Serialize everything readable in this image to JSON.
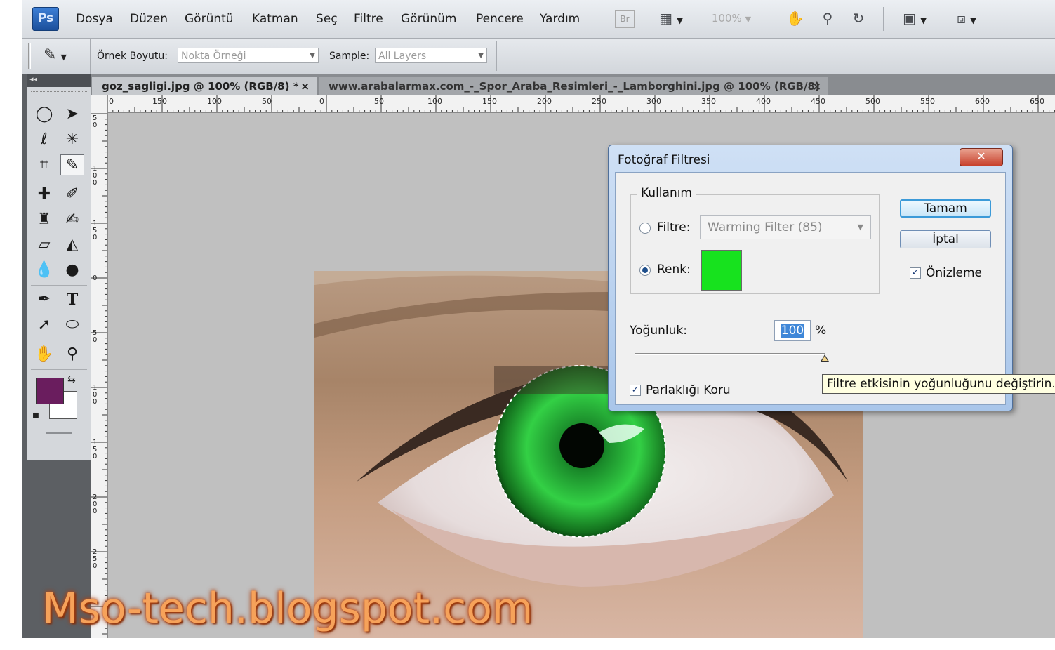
{
  "app": {
    "logo": "Ps",
    "menu": [
      "Dosya",
      "Düzen",
      "Görüntü",
      "Katman",
      "Seç",
      "Filtre",
      "Görünüm",
      "Pencere",
      "Yardım"
    ],
    "bridge_label": "Br",
    "zoom": "100%"
  },
  "options_bar": {
    "sample_size_label": "Örnek Boyutu:",
    "sample_size_value": "Nokta Örneği",
    "sample_label": "Sample:",
    "sample_value": "All Layers"
  },
  "tabs": [
    {
      "label": "goz_sagligi.jpg @ 100% (RGB/8) *",
      "close": "×"
    },
    {
      "label": "www.arabalarmax.com_-_Spor_Araba_Resimleri_-_Lamborghini.jpg @ 100% (RGB/8)",
      "close": "×"
    }
  ],
  "rulers": {
    "horizontal": [
      "0",
      "150",
      "100",
      "50",
      "0",
      "50",
      "100",
      "150",
      "200",
      "250",
      "300",
      "350",
      "400",
      "450",
      "500",
      "550",
      "600",
      "650"
    ],
    "vertical": [
      "50",
      "100",
      "150",
      "0",
      "50",
      "100",
      "150",
      "200",
      "250"
    ]
  },
  "toolbar": {
    "foreground_color": "#6a1d5e",
    "background_color": "#ffffff",
    "tools": [
      "marquee-tool",
      "move-tool",
      "lasso-tool",
      "magic-wand-tool",
      "crop-tool",
      "eyedropper-tool",
      "healing-brush-tool",
      "brush-tool",
      "clone-stamp-tool",
      "history-brush-tool",
      "eraser-tool",
      "paint-bucket-tool",
      "blur-tool",
      "dodge-tool",
      "pen-tool",
      "type-tool",
      "path-selection-tool",
      "ellipse-tool",
      "hand-tool",
      "zoom-tool"
    ]
  },
  "dialog": {
    "title": "Fotoğraf Filtresi",
    "close": "✕",
    "group_label": "Kullanım",
    "filter_label": "Filtre:",
    "filter_value": "Warming Filter (85)",
    "color_label": "Renk:",
    "color_value": "#17e21e",
    "ok_button": "Tamam",
    "cancel_button": "İptal",
    "preview_label": "Önizleme",
    "preview_checked": true,
    "density_label": "Yoğunluk:",
    "density_value": "100",
    "density_unit": "%",
    "density_fraction": 1.0,
    "preserve_luminosity_label": "Parlaklığı Koru",
    "preserve_luminosity_checked": true
  },
  "tooltip": "Filtre etkisinin yoğunluğunu değiştirin.",
  "watermark": "Mso-tech.blogspot.com"
}
